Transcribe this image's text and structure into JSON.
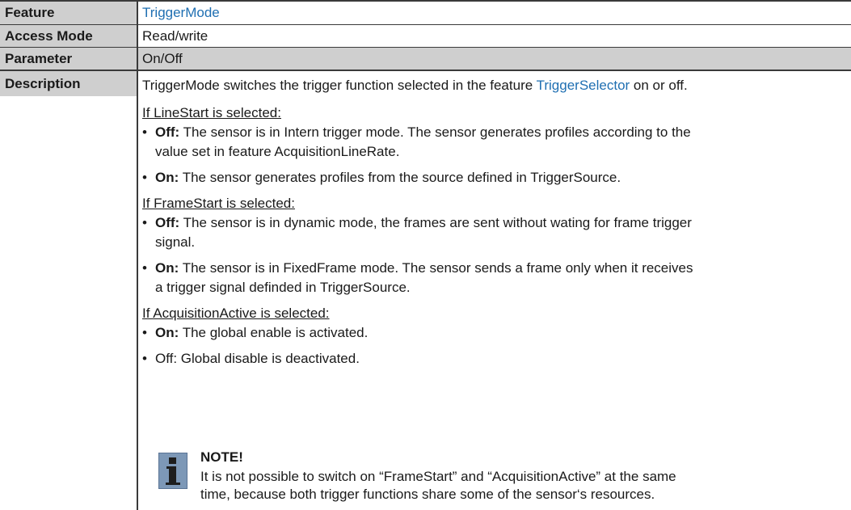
{
  "table": {
    "rows": [
      {
        "key": "Feature",
        "value_link": "TriggerMode"
      },
      {
        "key": "Access Mode",
        "value": "Read/write"
      },
      {
        "key": "Parameter",
        "value": "On/Off"
      },
      {
        "key": "Description"
      }
    ]
  },
  "description": {
    "intro_prefix": "TriggerMode switches the trigger function selected in the feature ",
    "intro_link": "TriggerSelector",
    "intro_suffix": " on or off.",
    "sections": [
      {
        "heading": "If LineStart is selected:",
        "items": [
          {
            "bold": "Off:",
            "lines": [
              " The sensor is in Intern trigger mode. The sensor generates profiles according to the",
              "value set in feature AcquisitionLineRate."
            ]
          },
          {
            "bold": "On:",
            "lines": [
              " The sensor generates profiles from the source defined in TriggerSource."
            ]
          }
        ]
      },
      {
        "heading": "If FrameStart is selected:",
        "items": [
          {
            "bold": "Off:",
            "lines": [
              " The sensor is in dynamic mode, the frames are sent without wating for frame trigger",
              "signal."
            ]
          },
          {
            "bold": "On:",
            "lines": [
              " The sensor is in FixedFrame mode. The sensor sends a frame only when it receives",
              "a trigger signal definded in TriggerSource."
            ]
          }
        ]
      },
      {
        "heading": "If AcquisitionActive is selected:",
        "items": [
          {
            "bold": "On:",
            "lines": [
              " The global enable is activated."
            ]
          },
          {
            "bold": "",
            "lines": [
              "Off: Global disable is deactivated."
            ]
          }
        ]
      }
    ]
  },
  "note": {
    "icon": "info-icon",
    "title": "NOTE!",
    "line1": "It is not possible to switch on “FrameStart” and “AcquisitionActive” at the same",
    "line2": "time, because both trigger functions share some of the sensor‘s resources."
  }
}
